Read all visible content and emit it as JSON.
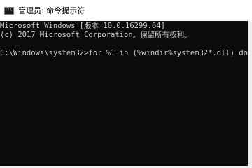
{
  "window": {
    "title": "管理员: 命令提示符",
    "icon": "cmd-icon"
  },
  "console": {
    "lines": [
      "Microsoft Windows [版本 10.0.16299.64]",
      "(c) 2017 Microsoft Corporation。保留所有权利。",
      "",
      "C:\\Windows\\system32>for %1 in (%windir%system32*.dll) do"
    ]
  },
  "colors": {
    "console_background": "#0c0c0c",
    "console_text": "#cccccc",
    "titlebar_background": "#ffffff"
  }
}
